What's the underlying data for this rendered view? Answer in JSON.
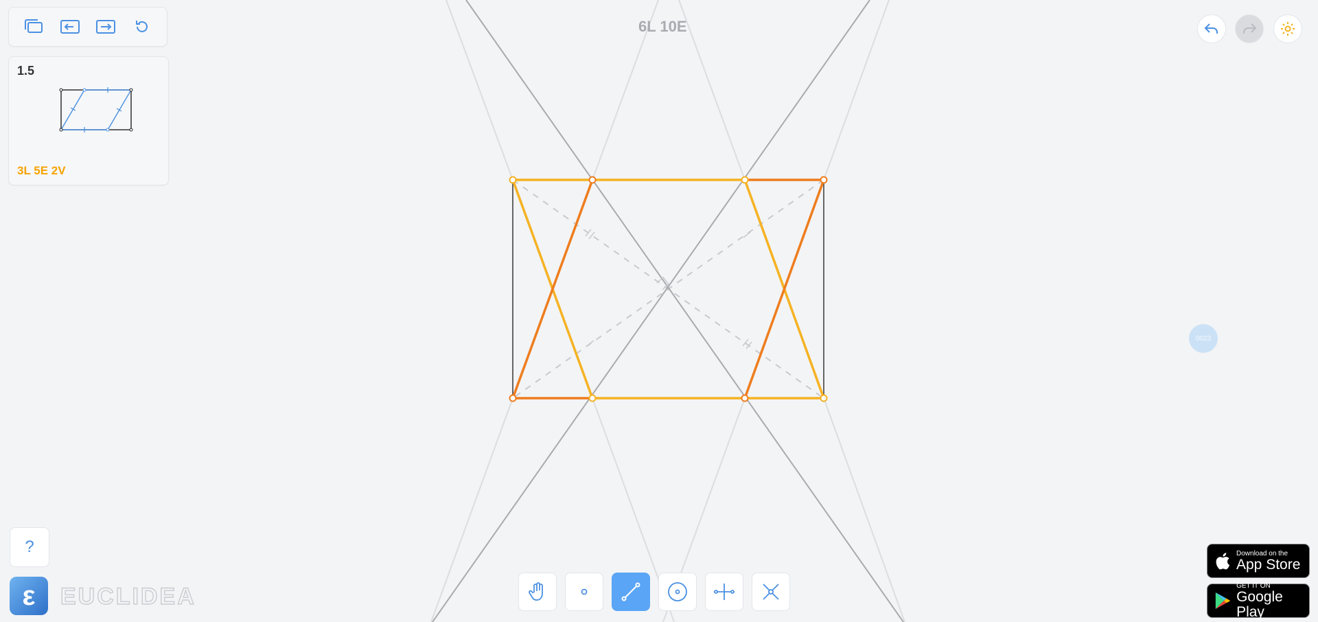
{
  "status_text": "6L 10E",
  "level": {
    "number": "1.5",
    "score": "3L  5E 2V"
  },
  "help_label": "?",
  "logo_letter": "ε",
  "brand_wordmark": "EUCLIDEA",
  "bubble_text": "0023",
  "app_store": {
    "line1": "Download on the",
    "line2": "App Store"
  },
  "google_play": {
    "line1": "GET IT ON",
    "line2": "Google Play"
  },
  "colors": {
    "accent": "#4a90e2",
    "gold": "#f5a300",
    "orange": "#ee7d1e",
    "yellow": "#f5b223"
  },
  "top_toolbar": [
    "copy-icon",
    "previous-level-icon",
    "next-level-icon",
    "restart-icon"
  ],
  "tools": [
    "move-hand",
    "point",
    "line",
    "circle",
    "perpendicular-bisector",
    "intersect"
  ],
  "active_tool": "line"
}
